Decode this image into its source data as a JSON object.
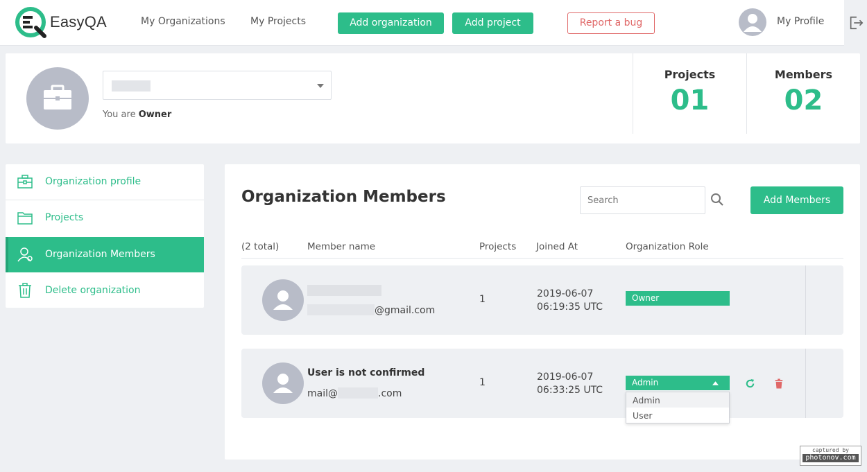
{
  "header": {
    "app_name": "EasyQA",
    "nav": [
      "My Organizations",
      "My Projects"
    ],
    "add_org_label": "Add organization",
    "add_project_label": "Add project",
    "report_bug_label": "Report a bug",
    "profile_label": "My Profile"
  },
  "org": {
    "selected_value": "",
    "role_prefix": "You are",
    "role": "Owner",
    "stats": [
      {
        "label": "Projects",
        "value": "01"
      },
      {
        "label": "Members",
        "value": "02"
      }
    ]
  },
  "sidebar": {
    "items": [
      {
        "label": "Organization profile",
        "icon": "briefcase-icon"
      },
      {
        "label": "Projects",
        "icon": "folder-icon"
      },
      {
        "label": "Organization Members",
        "icon": "members-icon"
      },
      {
        "label": "Delete organization",
        "icon": "trash-icon"
      }
    ],
    "active_index": 2
  },
  "main": {
    "title": "Organization Members",
    "search_placeholder": "Search",
    "add_members_label": "Add Members",
    "columns": [
      "(2  total)",
      "Member name",
      "Projects",
      "Joined At",
      "Organization Role"
    ],
    "members": [
      {
        "name": "",
        "email_suffix": "@gmail.com",
        "projects": "1",
        "joined_date": "2019-06-07",
        "joined_time": "06:19:35 UTC",
        "role": "Owner"
      },
      {
        "name": "User is not confirmed",
        "email_prefix": "mail@",
        "email_suffix": ".com",
        "projects": "1",
        "joined_date": "2019-06-07",
        "joined_time": "06:33:25 UTC",
        "role": "Admin"
      }
    ],
    "role_options": [
      "Admin",
      "User"
    ]
  },
  "watermark": {
    "line1": "captured by",
    "line2": "photonov.com"
  },
  "colors": {
    "accent": "#2dbd8a",
    "danger": "#e06767",
    "avatar": "#b8bcc8"
  }
}
